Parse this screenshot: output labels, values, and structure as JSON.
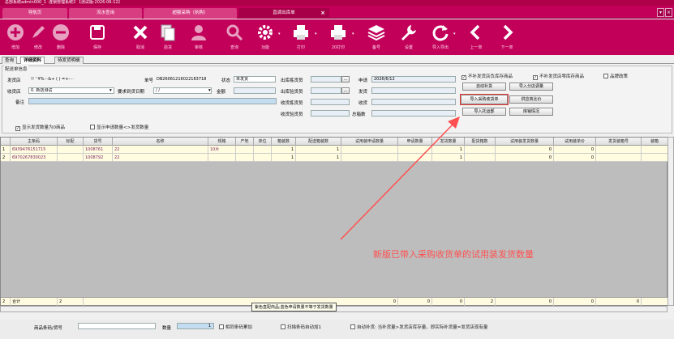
{
  "title_bar": "总部系统admin000_1 ·连锁管理系统2   【测试版:2026-06-12】",
  "tabs": [
    {
      "label": "导航页"
    },
    {
      "label": "流水查询"
    },
    {
      "label": "超额采购（执购）"
    },
    {
      "label": "直调出库单",
      "active": true
    }
  ],
  "toolbar": [
    {
      "label": "增加",
      "icon": "plus-circle-icon"
    },
    {
      "label": "修改",
      "icon": "pencil-icon"
    },
    {
      "label": "删除",
      "icon": "minus-circle-icon"
    },
    {
      "label": "保存",
      "icon": "floppy-icon"
    },
    {
      "label": "取消",
      "icon": "x-icon"
    },
    {
      "label": "验货",
      "icon": "documents-icon"
    },
    {
      "label": "审核",
      "icon": "person-icon"
    },
    {
      "label": "查询",
      "icon": "magnifier-icon"
    },
    {
      "label": "功能",
      "icon": "gear-icon"
    },
    {
      "label": "打印",
      "icon": "printer-icon"
    },
    {
      "label": "20打印",
      "icon": "printer-icon"
    },
    {
      "label": "备号",
      "icon": "layers-icon"
    },
    {
      "label": "设置",
      "icon": "wrench-icon"
    },
    {
      "label": "导入导出",
      "icon": "refresh-icon"
    },
    {
      "label": "上一单",
      "icon": "left-chevron-icon"
    },
    {
      "label": "下一单",
      "icon": "right-chevron-icon"
    }
  ],
  "subtabs": [
    "查询",
    "详细资料",
    "待发货明细"
  ],
  "panel": {
    "title": "配送单信息",
    "ship_store_label": "发货店",
    "ship_store_value": "!! ' ¥%···&+ ( ) =+-···",
    "recv_store_label": "收货店",
    "recv_store_value": "0. 新店测试",
    "note_label": "备注",
    "order_no_label": "单号",
    "order_no_value": "DB26061216022183718",
    "status_label": "状态",
    "status_value": "未发货",
    "arrival_label": "要求到货日期",
    "arrival_value": "/    /",
    "amount_label": "金额",
    "out_recheck_label": "出库拣货员",
    "out_verify_label": "出库验货员",
    "recv_picker_label": "收货拣货员",
    "recv_verify_label": "收货验货员",
    "apply_label": "申请",
    "apply_value": "2026/6/12",
    "ship_label": "发货",
    "recv_label": "收货",
    "total_boxes_label": "总箱数"
  },
  "checkboxes": [
    {
      "label": "不补发货店负库存商品",
      "checked": true
    },
    {
      "label": "不补发货店零库存商品",
      "checked": true
    },
    {
      "label": "品牌政策",
      "checked": false
    },
    {
      "label": "显示发货数量为0商品",
      "checked": true
    },
    {
      "label": "显示申请数量<>发货数量",
      "checked": false
    }
  ],
  "buttons": {
    "auto_fill": "自动补货",
    "import_branch": "导入分店调量",
    "import_purchase": "导入采购收货单",
    "supplier_compare": "供应商比价",
    "import_consign": "导入托运部",
    "stock_status": "库销情况"
  },
  "grid": {
    "headers": [
      "主条码",
      "标配",
      "货号",
      "名称",
      "规格",
      "产地",
      "单位",
      "箱装数",
      "配送箱装数",
      "试用装申请数量",
      "申请数量",
      "发货数量",
      "配货箱数",
      "试用装发货数量",
      "试用装单价",
      "发货装箱号",
      "装箱"
    ],
    "rows": [
      [
        "6939476151715",
        "",
        "1008761",
        "22",
        "10片",
        "",
        "",
        "1",
        "1",
        "",
        "",
        "1",
        "",
        "0",
        "0",
        "",
        ""
      ],
      [
        "6970267830023",
        "",
        "1008792",
        "22",
        "",
        "",
        "",
        "1",
        "1",
        "",
        "",
        "1",
        "",
        "0",
        "0",
        "",
        ""
      ]
    ],
    "row_numbers": [
      "1",
      "2"
    ],
    "total_label": "合计",
    "total_count": "2",
    "total_row_no": "2",
    "totals": [
      "0",
      "0",
      "0",
      "2",
      "0",
      "0",
      "0"
    ]
  },
  "tooltip": "紫色直配商品;蓝色申请数量不等于发货数量",
  "bottom": {
    "barcode_label": "商品条码/货号",
    "qty_label": "数量",
    "qty_value": "1",
    "same_barcode_label": "相同条码累加",
    "scan_add_label": "扫描条码自动加1",
    "auto_fill_note": "自动补货: 当补货量>发货店库存量，即实际补货量=发货店现有量"
  },
  "annotation": "新版已带入采购收货单的试用装发货数量",
  "colors": {
    "brand": "#c2005a",
    "annotation": "#ff5050",
    "selected_row": "#fffce0"
  }
}
